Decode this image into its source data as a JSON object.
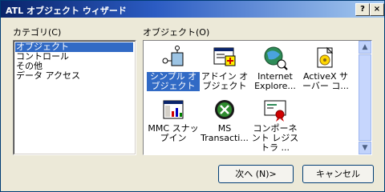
{
  "window": {
    "title": "ATL オブジェクト ウィザード",
    "help_icon": "?",
    "close_icon": "×"
  },
  "categories": {
    "label": "カテゴリ(C)",
    "items": [
      "オブジェクト",
      "コントロール",
      "その他",
      "データ アクセス"
    ],
    "selected_index": 0
  },
  "objects": {
    "label": "オブジェクト(O)",
    "items": [
      {
        "name": "シンプル オブジェクト",
        "icon": "simple-object-icon",
        "selected": true
      },
      {
        "name": "アドイン オブジェクト",
        "icon": "addin-object-icon"
      },
      {
        "name": "Internet Explore...",
        "icon": "internet-explorer-icon"
      },
      {
        "name": "ActiveX サーバー コ...",
        "icon": "activex-server-icon"
      },
      {
        "name": "MMC スナップイン",
        "icon": "mmc-snapin-icon"
      },
      {
        "name": "MS Transacti...",
        "icon": "ms-transaction-icon"
      },
      {
        "name": "コンポーネント レジストラ ...",
        "icon": "component-registrar-icon"
      }
    ]
  },
  "buttons": {
    "next": "次へ (N)>",
    "cancel": "キャンセル"
  }
}
